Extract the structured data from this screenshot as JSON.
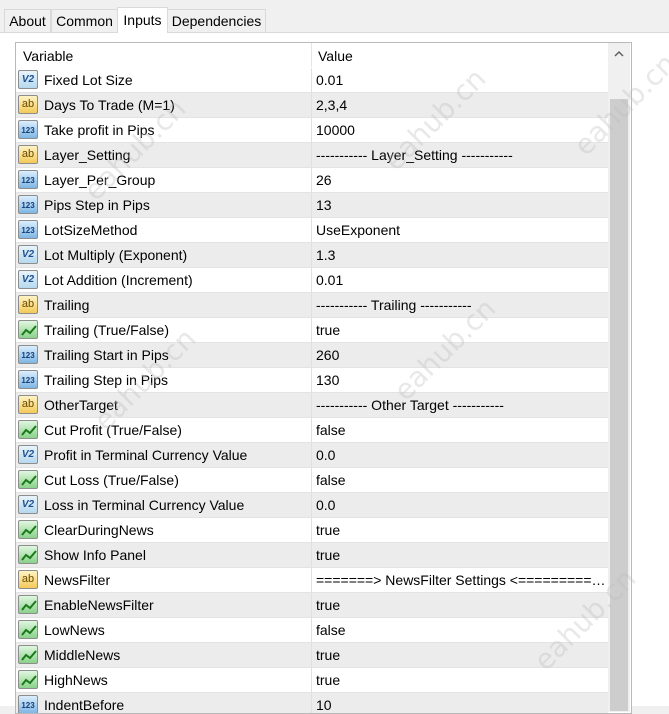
{
  "tabs": [
    {
      "label": "About"
    },
    {
      "label": "Common"
    },
    {
      "label": "Inputs"
    },
    {
      "label": "Dependencies"
    }
  ],
  "active_tab": "Inputs",
  "columns": {
    "variable": "Variable",
    "value": "Value"
  },
  "rows": [
    {
      "name": "Fixed Lot Size",
      "value": "0.01",
      "type": "v2"
    },
    {
      "name": "Days To Trade (M=1)",
      "value": "2,3,4",
      "type": "ab"
    },
    {
      "name": "Take profit in Pips",
      "value": "10000",
      "type": "123"
    },
    {
      "name": "Layer_Setting",
      "value": "----------- Layer_Setting -----------",
      "type": "ab"
    },
    {
      "name": "Layer_Per_Group",
      "value": "26",
      "type": "123"
    },
    {
      "name": "Pips Step in Pips",
      "value": "13",
      "type": "123"
    },
    {
      "name": "LotSizeMethod",
      "value": "UseExponent",
      "type": "123"
    },
    {
      "name": "Lot Multiply (Exponent)",
      "value": "1.3",
      "type": "v2"
    },
    {
      "name": "Lot Addition (Increment)",
      "value": "0.01",
      "type": "v2"
    },
    {
      "name": "Trailing",
      "value": "----------- Trailing -----------",
      "type": "ab"
    },
    {
      "name": "Trailing (True/False)",
      "value": "true",
      "type": "tf"
    },
    {
      "name": "Trailing Start in Pips",
      "value": "260",
      "type": "123"
    },
    {
      "name": "Trailing Step in Pips",
      "value": "130",
      "type": "123"
    },
    {
      "name": "OtherTarget",
      "value": "----------- Other Target -----------",
      "type": "ab"
    },
    {
      "name": "Cut Profit (True/False)",
      "value": "false",
      "type": "tf"
    },
    {
      "name": "Profit in Terminal Currency Value",
      "value": "0.0",
      "type": "v2"
    },
    {
      "name": "Cut Loss (True/False)",
      "value": "false",
      "type": "tf"
    },
    {
      "name": "Loss in Terminal Currency Value",
      "value": "0.0",
      "type": "v2"
    },
    {
      "name": "ClearDuringNews",
      "value": "true",
      "type": "tf"
    },
    {
      "name": "Show Info Panel",
      "value": "true",
      "type": "tf"
    },
    {
      "name": "NewsFilter",
      "value": "=======>  NewsFilter Settings <=============...",
      "type": "ab"
    },
    {
      "name": "EnableNewsFilter",
      "value": "true",
      "type": "tf"
    },
    {
      "name": "LowNews",
      "value": "false",
      "type": "tf"
    },
    {
      "name": "MiddleNews",
      "value": "true",
      "type": "tf"
    },
    {
      "name": "HighNews",
      "value": "true",
      "type": "tf"
    },
    {
      "name": "IndentBefore",
      "value": "10",
      "type": "123"
    }
  ],
  "type_icons": {
    "v2": {
      "glyph": "V2",
      "icon": "double-value-icon"
    },
    "ab": {
      "glyph": "ab",
      "icon": "string-value-icon"
    },
    "123": {
      "glyph": "123",
      "icon": "integer-value-icon"
    },
    "tf": {
      "glyph": "",
      "icon": "boolean-value-icon"
    }
  },
  "watermarks": [
    "eahub.cn",
    "eahub.cn",
    "eahub.cn",
    "eahub.cn",
    "eahub.cn",
    "eahub.cn"
  ]
}
